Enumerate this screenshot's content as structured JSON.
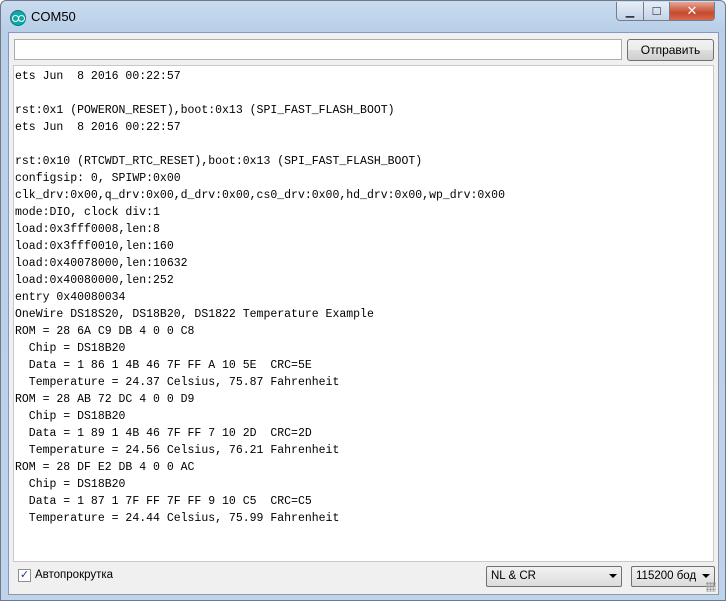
{
  "window": {
    "title": "COM50",
    "controls": {
      "minimize": "▁",
      "maximize": "☐",
      "close": "✕"
    }
  },
  "send": {
    "input_value": "",
    "button_label": "Отправить"
  },
  "output_lines": [
    "ets Jun  8 2016 00:22:57",
    "",
    "rst:0x1 (POWERON_RESET),boot:0x13 (SPI_FAST_FLASH_BOOT)",
    "ets Jun  8 2016 00:22:57",
    "",
    "rst:0x10 (RTCWDT_RTC_RESET),boot:0x13 (SPI_FAST_FLASH_BOOT)",
    "configsip: 0, SPIWP:0x00",
    "clk_drv:0x00,q_drv:0x00,d_drv:0x00,cs0_drv:0x00,hd_drv:0x00,wp_drv:0x00",
    "mode:DIO, clock div:1",
    "load:0x3fff0008,len:8",
    "load:0x3fff0010,len:160",
    "load:0x40078000,len:10632",
    "load:0x40080000,len:252",
    "entry 0x40080034",
    "OneWire DS18S20, DS18B20, DS1822 Temperature Example",
    "ROM = 28 6A C9 DB 4 0 0 C8",
    "  Chip = DS18B20",
    "  Data = 1 86 1 4B 46 7F FF A 10 5E  CRC=5E",
    "  Temperature = 24.37 Celsius, 75.87 Fahrenheit",
    "ROM = 28 AB 72 DC 4 0 0 D9",
    "  Chip = DS18B20",
    "  Data = 1 89 1 4B 46 7F FF 7 10 2D  CRC=2D",
    "  Temperature = 24.56 Celsius, 76.21 Fahrenheit",
    "ROM = 28 DF E2 DB 4 0 0 AC",
    "  Chip = DS18B20",
    "  Data = 1 87 1 7F FF 7F FF 9 10 C5  CRC=C5",
    "  Temperature = 24.44 Celsius, 75.99 Fahrenheit"
  ],
  "footer": {
    "autoscroll_checked": true,
    "autoscroll_mark": "✓",
    "autoscroll_label": "Автопрокрутка",
    "line_ending": "NL & CR",
    "baud_rate": "115200 бод"
  },
  "icons": {
    "app": "arduino-icon",
    "checkbox": "checkmark-icon",
    "dropdown": "chevron-down-icon"
  }
}
